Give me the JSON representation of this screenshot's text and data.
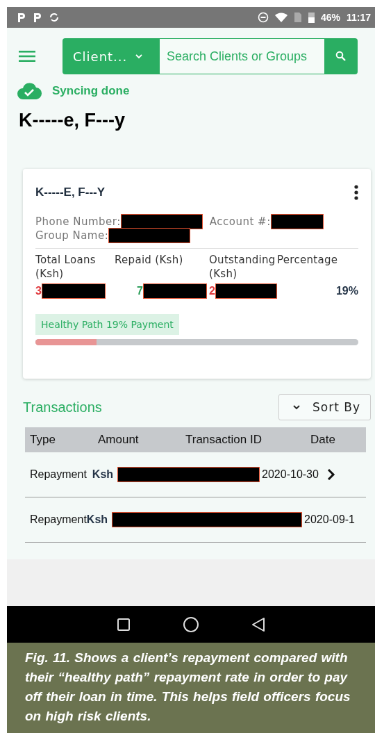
{
  "status_bar": {
    "battery": "46%",
    "time": "11:17"
  },
  "header": {
    "filter": "Client...",
    "search": {
      "placeholder": "Search Clients or Groups"
    }
  },
  "sync_status": "Syncing done",
  "client_name": "K-----e, F---y",
  "card": {
    "name": "K-----E, F---Y",
    "phone_label": "Phone Number:",
    "account_label": "Account #:",
    "group_label": "Group Name:",
    "stats": [
      {
        "label": "Total Loans (Ksh)",
        "value": "3",
        "color": "#e03a3e",
        "redacted": true
      },
      {
        "label": "Repaid (Ksh)",
        "value": "7",
        "color": "#2e9e5b",
        "redacted": true
      },
      {
        "label": "Outstanding (Ksh)",
        "value": "2",
        "color": "#e03a3e",
        "redacted": true
      },
      {
        "label": "Percentage",
        "value": "19%",
        "color": "#243447",
        "redacted": false
      }
    ],
    "healthy_path": "Healthy Path 19% Payment",
    "level": 0.19
  },
  "transactions": {
    "title": "Transactions",
    "sort_button": "Sort By",
    "columns": [
      "Type",
      "Amount",
      "Transaction ID",
      "Date"
    ],
    "rows": [
      {
        "type": "Repayment",
        "currency": "Ksh",
        "date": "2020-10-30",
        "chevron": true
      },
      {
        "type": "Repayment",
        "currency": "Ksh",
        "date": "2020-09-1",
        "chevron": false
      }
    ]
  },
  "caption": "Fig. 11. Shows a client’s repayment compared with their “healthy path” repayment rate in order to pay off their loan in time. This helps field officers focus on high risk clients."
}
